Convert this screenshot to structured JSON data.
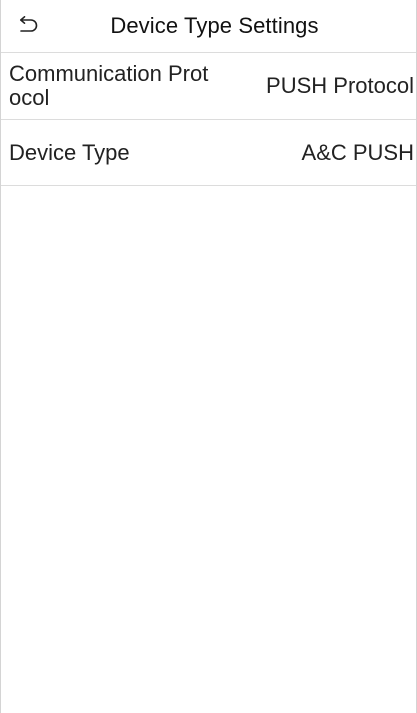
{
  "header": {
    "back_icon": "return-arrow-icon",
    "title": "Device Type Settings"
  },
  "settings": {
    "items": [
      {
        "label": "Communication Protocol",
        "value": "PUSH Protocol"
      },
      {
        "label": "Device Type",
        "value": "A&C PUSH"
      }
    ]
  },
  "colors": {
    "background": "#ffffff",
    "divider": "#dcdcdc",
    "text": "#222222"
  }
}
